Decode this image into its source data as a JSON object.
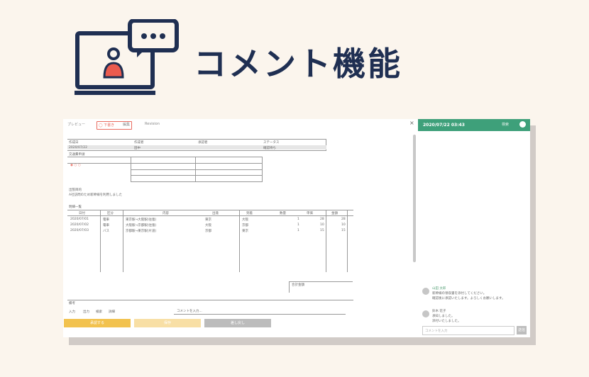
{
  "hero": {
    "title": "コメント機能",
    "icon": "laptop-user-comment-icon",
    "colors": {
      "navy": "#1f2f52",
      "accent": "#ea5b4f",
      "bg": "#fbf5ed"
    }
  },
  "window": {
    "tab_inactive_1": "プレビュー",
    "tab_active": "◯ 下書き",
    "tab_inactive_2": "編集",
    "tab_revision": "Revision",
    "close": "×"
  },
  "form": {
    "header_row": [
      "作成日",
      "作成者",
      "承認者",
      "ステータス"
    ],
    "date": "2020/07/22",
    "author": "田中",
    "status": "確認待ち",
    "section_1": "交通費申請",
    "purpose_label": "出張目的",
    "purpose_text": "A社訪問のため新幹線を利用しました",
    "section_2": "明細一覧",
    "table_headers": [
      "日付",
      "区分",
      "内容",
      "出発",
      "到着",
      "数量",
      "単価",
      "金額"
    ],
    "rows": [
      {
        "date": "2020/07/01",
        "kind": "電車",
        "desc": "東京駅→大阪駅(往復)",
        "from": "東京",
        "to": "大阪",
        "qty": "1",
        "price": "28",
        "amount": "28"
      },
      {
        "date": "2020/07/02",
        "kind": "電車",
        "desc": "大阪駅→京都駅(往復)",
        "from": "大阪",
        "to": "京都",
        "qty": "1",
        "price": "10",
        "amount": "10"
      },
      {
        "date": "2020/07/03",
        "kind": "バス",
        "desc": "京都駅→東京駅(片道)",
        "from": "京都",
        "to": "東京",
        "qty": "1",
        "price": "15",
        "amount": "15"
      }
    ],
    "total_label": "合計金額",
    "bottom_label": "備考",
    "footer_toggles": [
      "入力",
      "出力",
      "検索",
      "詳細"
    ],
    "remark_placeholder": "コメントを入力..."
  },
  "buttons": {
    "primary": "承認する",
    "secondary": "保存",
    "tertiary": "差し戻し",
    "colors": {
      "primary": "#f2c24e",
      "secondary": "#f8dfa5",
      "tertiary": "#bcbcbc"
    }
  },
  "comments": {
    "header_date": "2020/07/22 03:43",
    "search_label": "検索",
    "header_color": "#3ea07a",
    "items": [
      {
        "author": "山田 太郎",
        "lines": [
          "新幹線の領収書を添付してください。",
          "確認後に承認いたします。よろしくお願いします。"
        ]
      },
      {
        "author": "鈴木 花子",
        "lines": [
          "承知しました。",
          "添付いたしました。"
        ]
      }
    ],
    "input_placeholder": "コメントを入力",
    "send_label": "送信"
  }
}
